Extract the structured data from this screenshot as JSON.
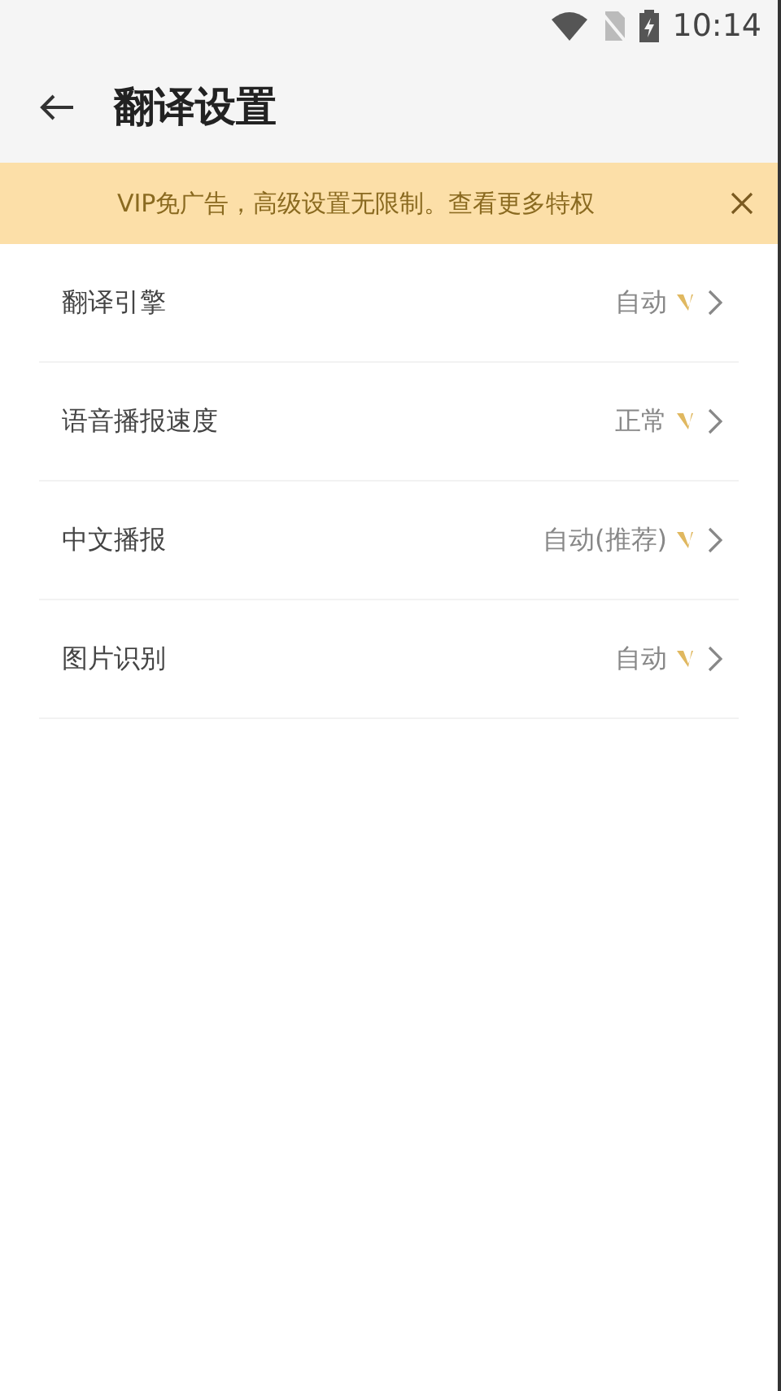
{
  "status_bar": {
    "time": "10:14"
  },
  "header": {
    "title": "翻译设置"
  },
  "banner": {
    "text": "VIP免广告，高级设置无限制。查看更多特权"
  },
  "settings": [
    {
      "label": "翻译引擎",
      "value": "自动",
      "vip": true
    },
    {
      "label": "语音播报速度",
      "value": "正常",
      "vip": true
    },
    {
      "label": "中文播报",
      "value": "自动(推荐)",
      "vip": true
    },
    {
      "label": "图片识别",
      "value": "自动",
      "vip": true
    }
  ]
}
